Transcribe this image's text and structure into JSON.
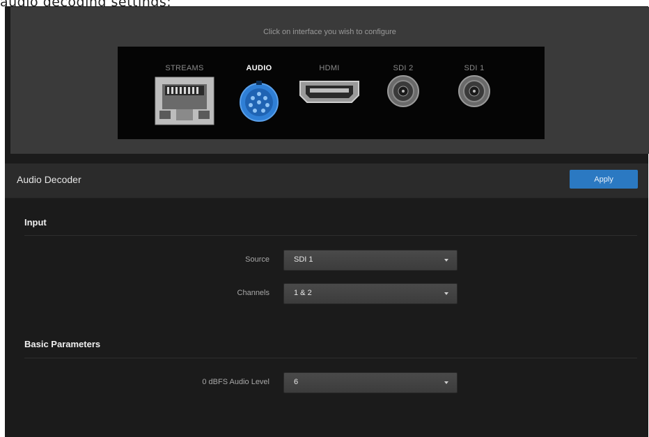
{
  "caption": "audio decoding settings:",
  "config_hint": "Click on interface you wish to configure",
  "interfaces": [
    {
      "label": "STREAMS",
      "active": false,
      "icon": "ethernet-port-icon"
    },
    {
      "label": "AUDIO",
      "active": true,
      "icon": "audio-connector-icon"
    },
    {
      "label": "HDMI",
      "active": false,
      "icon": "hdmi-port-icon"
    },
    {
      "label": "SDI 2",
      "active": false,
      "icon": "bnc-connector-icon"
    },
    {
      "label": "SDI 1",
      "active": false,
      "icon": "bnc-connector-icon"
    }
  ],
  "section": {
    "title": "Audio Decoder",
    "apply_label": "Apply"
  },
  "input": {
    "title": "Input",
    "source_label": "Source",
    "source_value": "SDI 1",
    "channels_label": "Channels",
    "channels_value": "1 & 2"
  },
  "basic": {
    "title": "Basic Parameters",
    "level_label": "0 dBFS Audio Level",
    "level_value": "6"
  },
  "colors": {
    "accent": "#2b79c2",
    "active_connector": "#2f7fd6",
    "background": "#1b1b1b",
    "panel": "#3a3a3a"
  }
}
